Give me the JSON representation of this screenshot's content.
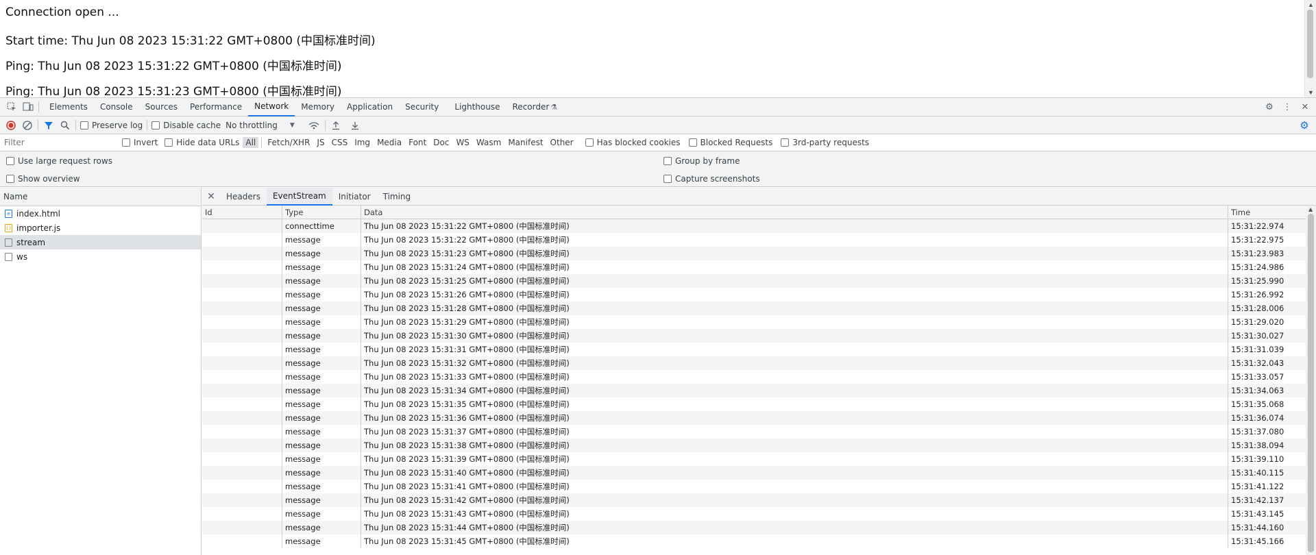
{
  "page": {
    "lines": [
      "Connection open ...",
      "Start time: Thu Jun 08 2023 15:31:22 GMT+0800 (中国标准时间)",
      "Ping: Thu Jun 08 2023 15:31:22 GMT+0800 (中国标准时间)",
      "Ping: Thu Jun 08 2023 15:31:23 GMT+0800 (中国标准时间)"
    ]
  },
  "devtools": {
    "tabs": [
      "Elements",
      "Console",
      "Sources",
      "Performance",
      "Network",
      "Memory",
      "Application",
      "Security",
      "Lighthouse",
      "Recorder"
    ],
    "active_tab": "Network",
    "toolbar": {
      "preserve_log": "Preserve log",
      "disable_cache": "Disable cache",
      "throttling": "No throttling"
    },
    "filter": {
      "placeholder": "Filter",
      "invert": "Invert",
      "hide_data_urls": "Hide data URLs",
      "types": [
        "All",
        "Fetch/XHR",
        "JS",
        "CSS",
        "Img",
        "Media",
        "Font",
        "Doc",
        "WS",
        "Wasm",
        "Manifest",
        "Other"
      ],
      "active_type": "All",
      "has_blocked_cookies": "Has blocked cookies",
      "blocked_requests": "Blocked Requests",
      "third_party": "3rd-party requests"
    },
    "settings": {
      "large_rows": "Use large request rows",
      "show_overview": "Show overview",
      "group_by_frame": "Group by frame",
      "capture_screenshots": "Capture screenshots"
    },
    "requests": {
      "header": "Name",
      "items": [
        {
          "name": "index.html",
          "icon": "html-file-icon"
        },
        {
          "name": "importer.js",
          "icon": "js-file-icon"
        },
        {
          "name": "stream",
          "icon": "doc-file-icon",
          "selected": true
        },
        {
          "name": "ws",
          "icon": "doc-file-icon"
        }
      ]
    },
    "detail_tabs": [
      "Headers",
      "EventStream",
      "Initiator",
      "Timing"
    ],
    "active_detail_tab": "EventStream",
    "event_stream": {
      "columns": [
        "Id",
        "Type",
        "Data",
        "Time"
      ],
      "rows": [
        {
          "id": "",
          "type": "connecttime",
          "data": "Thu Jun 08 2023 15:31:22 GMT+0800 (中国标准时间)",
          "time": "15:31:22.974"
        },
        {
          "id": "",
          "type": "message",
          "data": "Thu Jun 08 2023 15:31:22 GMT+0800 (中国标准时间)",
          "time": "15:31:22.975"
        },
        {
          "id": "",
          "type": "message",
          "data": "Thu Jun 08 2023 15:31:23 GMT+0800 (中国标准时间)",
          "time": "15:31:23.983"
        },
        {
          "id": "",
          "type": "message",
          "data": "Thu Jun 08 2023 15:31:24 GMT+0800 (中国标准时间)",
          "time": "15:31:24.986"
        },
        {
          "id": "",
          "type": "message",
          "data": "Thu Jun 08 2023 15:31:25 GMT+0800 (中国标准时间)",
          "time": "15:31:25.990"
        },
        {
          "id": "",
          "type": "message",
          "data": "Thu Jun 08 2023 15:31:26 GMT+0800 (中国标准时间)",
          "time": "15:31:26.992"
        },
        {
          "id": "",
          "type": "message",
          "data": "Thu Jun 08 2023 15:31:28 GMT+0800 (中国标准时间)",
          "time": "15:31:28.006"
        },
        {
          "id": "",
          "type": "message",
          "data": "Thu Jun 08 2023 15:31:29 GMT+0800 (中国标准时间)",
          "time": "15:31:29.020"
        },
        {
          "id": "",
          "type": "message",
          "data": "Thu Jun 08 2023 15:31:30 GMT+0800 (中国标准时间)",
          "time": "15:31:30.027"
        },
        {
          "id": "",
          "type": "message",
          "data": "Thu Jun 08 2023 15:31:31 GMT+0800 (中国标准时间)",
          "time": "15:31:31.039"
        },
        {
          "id": "",
          "type": "message",
          "data": "Thu Jun 08 2023 15:31:32 GMT+0800 (中国标准时间)",
          "time": "15:31:32.043"
        },
        {
          "id": "",
          "type": "message",
          "data": "Thu Jun 08 2023 15:31:33 GMT+0800 (中国标准时间)",
          "time": "15:31:33.057"
        },
        {
          "id": "",
          "type": "message",
          "data": "Thu Jun 08 2023 15:31:34 GMT+0800 (中国标准时间)",
          "time": "15:31:34.063"
        },
        {
          "id": "",
          "type": "message",
          "data": "Thu Jun 08 2023 15:31:35 GMT+0800 (中国标准时间)",
          "time": "15:31:35.068"
        },
        {
          "id": "",
          "type": "message",
          "data": "Thu Jun 08 2023 15:31:36 GMT+0800 (中国标准时间)",
          "time": "15:31:36.074"
        },
        {
          "id": "",
          "type": "message",
          "data": "Thu Jun 08 2023 15:31:37 GMT+0800 (中国标准时间)",
          "time": "15:31:37.080"
        },
        {
          "id": "",
          "type": "message",
          "data": "Thu Jun 08 2023 15:31:38 GMT+0800 (中国标准时间)",
          "time": "15:31:38.094"
        },
        {
          "id": "",
          "type": "message",
          "data": "Thu Jun 08 2023 15:31:39 GMT+0800 (中国标准时间)",
          "time": "15:31:39.110"
        },
        {
          "id": "",
          "type": "message",
          "data": "Thu Jun 08 2023 15:31:40 GMT+0800 (中国标准时间)",
          "time": "15:31:40.115"
        },
        {
          "id": "",
          "type": "message",
          "data": "Thu Jun 08 2023 15:31:41 GMT+0800 (中国标准时间)",
          "time": "15:31:41.122"
        },
        {
          "id": "",
          "type": "message",
          "data": "Thu Jun 08 2023 15:31:42 GMT+0800 (中国标准时间)",
          "time": "15:31:42.137"
        },
        {
          "id": "",
          "type": "message",
          "data": "Thu Jun 08 2023 15:31:43 GMT+0800 (中国标准时间)",
          "time": "15:31:43.145"
        },
        {
          "id": "",
          "type": "message",
          "data": "Thu Jun 08 2023 15:31:44 GMT+0800 (中国标准时间)",
          "time": "15:31:44.160"
        },
        {
          "id": "",
          "type": "message",
          "data": "Thu Jun 08 2023 15:31:45 GMT+0800 (中国标准时间)",
          "time": "15:31:45.166"
        }
      ]
    }
  }
}
